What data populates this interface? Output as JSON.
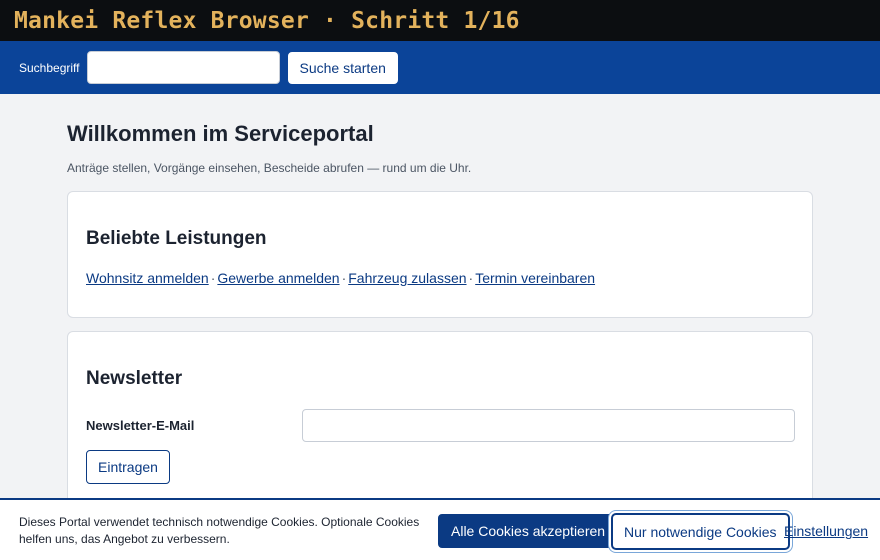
{
  "window": {
    "title": "Mankei Reflex Browser · Schritt 1/16"
  },
  "search": {
    "label": "Suchbegriff",
    "value": "",
    "placeholder": "",
    "button_label": "Suche starten"
  },
  "main": {
    "title": "Willkommen im Serviceportal",
    "subtitle": "Anträge stellen, Vorgänge einsehen, Bescheide abrufen — rund um die Uhr."
  },
  "popular": {
    "heading": "Beliebte Leistungen",
    "links": [
      "Wohnsitz anmelden",
      "Gewerbe anmelden",
      "Fahrzeug zulassen",
      "Termin vereinbaren"
    ],
    "separator": "·"
  },
  "newsletter": {
    "heading": "Newsletter",
    "email_label": "Newsletter-E-Mail",
    "email_value": "",
    "submit_label": "Eintragen"
  },
  "cookie_banner": {
    "text": "Dieses Portal verwendet technisch notwendige Cookies. Optionale Cookies helfen uns, das Angebot zu verbessern.",
    "accept_all_label": "Alle Cookies akzeptieren",
    "necessary_only_label": "Nur notwendige Cookies",
    "settings_label": "Einstellungen"
  },
  "colors": {
    "titlebar_bg": "#0c0e11",
    "titlebar_text": "#e3b25c",
    "header_bg": "#0b4499",
    "primary": "#0b3a83"
  }
}
